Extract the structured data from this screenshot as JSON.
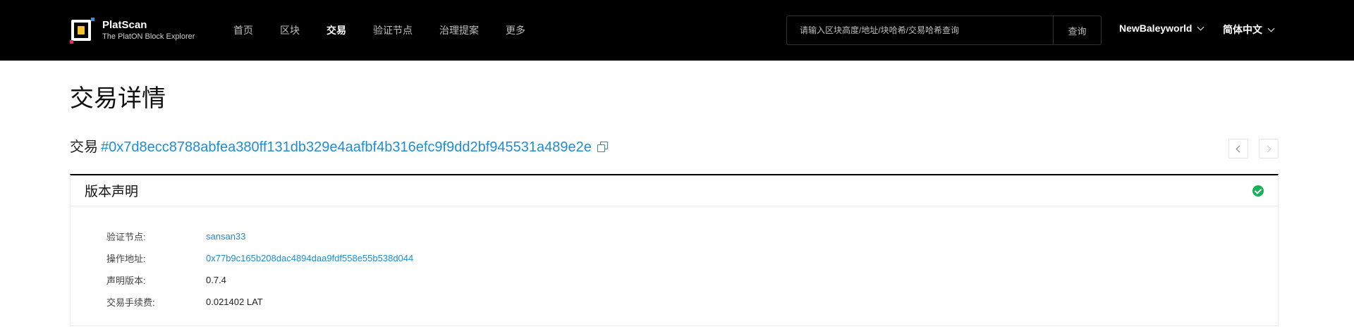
{
  "header": {
    "logo_title": "PlatScan",
    "logo_subtitle": "The PlatON Block Explorer",
    "nav": [
      {
        "label": "首页",
        "active": false
      },
      {
        "label": "区块",
        "active": false
      },
      {
        "label": "交易",
        "active": true
      },
      {
        "label": "验证节点",
        "active": false
      },
      {
        "label": "治理提案",
        "active": false
      },
      {
        "label": "更多",
        "active": false
      }
    ],
    "search": {
      "placeholder": "请输入区块高度/地址/块哈希/交易哈希查询",
      "button_label": "查询"
    },
    "network": "NewBaleyworld",
    "language": "简体中文"
  },
  "page": {
    "title": "交易详情",
    "tx_label": "交易",
    "tx_hash": "#0x7d8ecc8788abfea380ff131db329e4aafbf4b316efc9f9dd2bf945531a489e2e"
  },
  "card": {
    "title": "版本声明",
    "status": "success",
    "rows": [
      {
        "label": "验证节点:",
        "value": "sansan33",
        "link": true
      },
      {
        "label": "操作地址:",
        "value": "0x77b9c165b208dac4894daa9fdf558e55b538d044",
        "link": true
      },
      {
        "label": "声明版本:",
        "value": "0.7.4",
        "link": false
      },
      {
        "label": "交易手续费:",
        "value": "0.021402 LAT",
        "link": false
      }
    ]
  },
  "colors": {
    "header_bg": "#000000",
    "link": "#1f8dd6",
    "success": "#19b05a",
    "logo_accent_yellow": "#f5c12d",
    "logo_accent_pink": "#f0256b",
    "logo_accent_blue": "#3a8bf5"
  },
  "icons": [
    "platscan-logo-icon",
    "chevron-down-icon",
    "copy-icon",
    "chevron-left-icon",
    "chevron-right-icon",
    "check-circle-icon"
  ]
}
